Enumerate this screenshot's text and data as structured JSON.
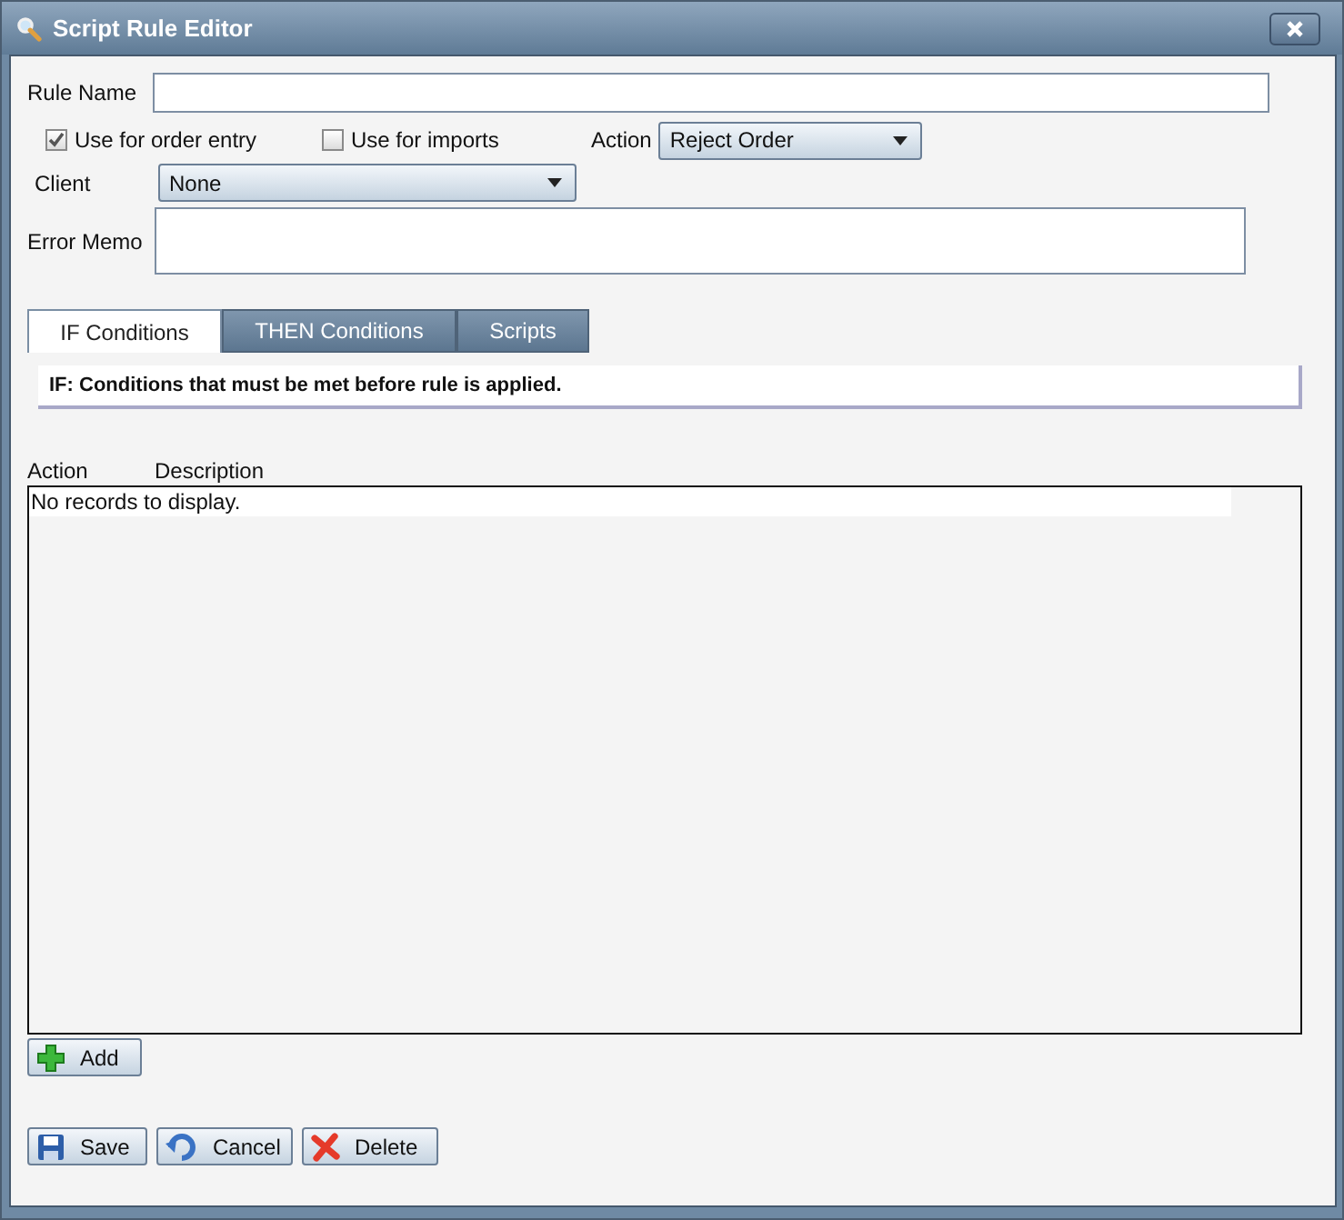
{
  "window": {
    "title": "Script Rule Editor"
  },
  "rule_name": {
    "label": "Rule Name"
  },
  "checkboxes": [
    {
      "label": "Use for order entry",
      "checked": true
    },
    {
      "label": "Use for imports",
      "checked": false
    }
  ],
  "action": {
    "label": "Action",
    "value": "Reject Order"
  },
  "client": {
    "label": "Client",
    "value": "None"
  },
  "error_memo": {
    "label": "Error Memo"
  },
  "tabs": [
    {
      "label": "IF Conditions",
      "selected": true
    },
    {
      "label": "THEN Conditions",
      "selected": false
    },
    {
      "label": "Scripts",
      "selected": false
    }
  ],
  "tab_description": "IF: Conditions that must be met before rule is applied.",
  "grid": {
    "columns": [
      "Action",
      "Description"
    ],
    "empty_message": "No records to display."
  },
  "add_button": {
    "label": "Add"
  },
  "buttons": [
    {
      "label": "Save",
      "kind": "save"
    },
    {
      "label": "Cancel",
      "kind": "cancel"
    },
    {
      "label": "Delete",
      "kind": "delete"
    }
  ]
}
